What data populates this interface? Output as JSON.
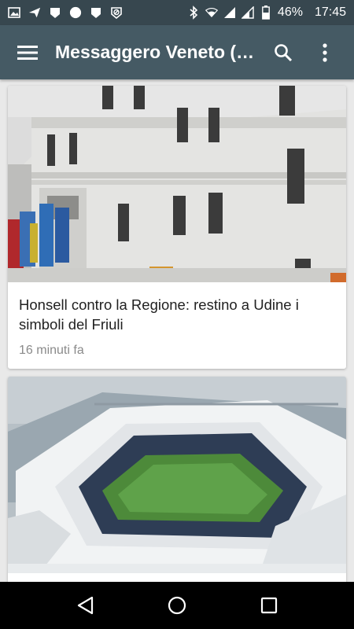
{
  "status_bar": {
    "battery": "46%",
    "time": "17:45"
  },
  "app_bar": {
    "title": "Messaggero Veneto (…"
  },
  "feed": {
    "articles": [
      {
        "title": "Honsell contro la Regione: restino a Udine i simboli del Friuli",
        "time": "16 minuti fa"
      },
      {
        "title": "",
        "time": ""
      }
    ]
  }
}
